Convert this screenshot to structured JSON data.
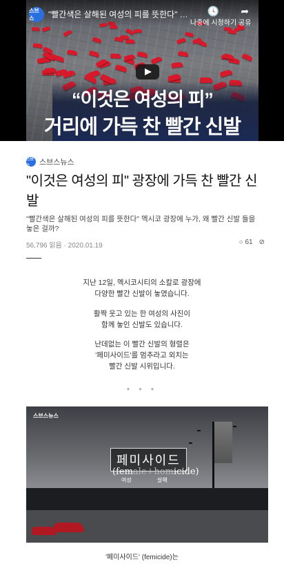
{
  "video": {
    "channel_badge": "스브스",
    "title": "\"빨간색은 살해된 여성의 피를 뜻한다\" 멕시...",
    "watch_later": "나중에 시청하기",
    "share": "공유",
    "headline_line1": "“이것은 여성의 피”",
    "headline_line2": "거리에 가득 찬 빨간 신발",
    "icons": {
      "watch_later": "clock-icon",
      "share": "share-arrow-icon",
      "play": "play-icon"
    }
  },
  "publisher": {
    "logo_text": "스브스",
    "name": "스브스뉴스"
  },
  "article": {
    "title": "\"이것은 여성의 피\" 광장에 가득 찬 빨간 신발",
    "summary": "\"빨간색은 살해된 여성의 피를 뜻한다\" 멕시코 광장에 누가, 왜 빨간 신발 들을 놓은 걸까?",
    "views": "56,796 읽음",
    "date": "2020.01.19",
    "comments": "61"
  },
  "body": {
    "paragraph1": "지난 12일, 멕시코시티의 소칼로 광장에\n다양한 빨간 신발이 놓였습니다.",
    "paragraph2": "활짝 웃고 있는 한 여성의 사진이\n함께 놓인 신발도 있습니다.",
    "paragraph3": "난데없는 이 빨간 신발의 형렬은\n'페미사이드'를 멈추라고 외치는\n빨간 신발 시위입니다.",
    "separator": "• • •"
  },
  "image": {
    "watermark": "스브스뉴스",
    "overlay_korean": "페미사이드",
    "overlay_english_open": "(fem",
    "overlay_english_mid": "ale+hom",
    "overlay_english_close": "icide)",
    "sub_woman": "여성",
    "sub_murder": "살해",
    "caption": "'페미사이드' (femicide)는"
  },
  "colors": {
    "brand_blue": "#2a6fe0",
    "headline_navy": "#1b2a55",
    "shoe_red": "#d7192b"
  }
}
